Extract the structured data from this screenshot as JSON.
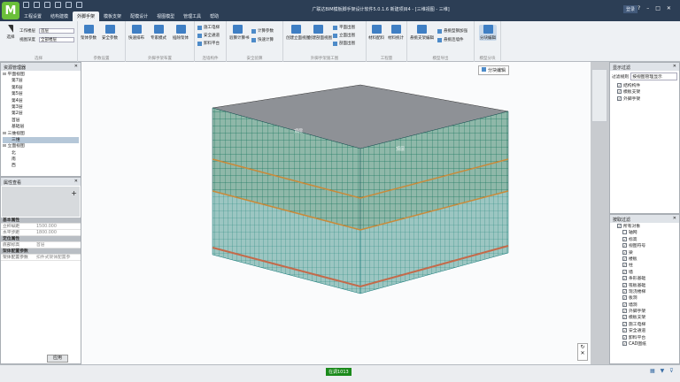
{
  "title": "广联达BIM模板脚手架设计软件5.0.1.6 新建项目4 - [三维视图 - 三维]",
  "menu": [
    "工程设置",
    "结构建模",
    "外脚手架",
    "模板支架",
    "配模设计",
    "视图模型",
    "管理工具",
    "帮助"
  ],
  "menu_active_index": 2,
  "login_label": "登录",
  "ribbon": {
    "select_label": "选择",
    "work_level_label": "工作楼层",
    "work_level_value": "首层",
    "view_type_label": "视图深度",
    "view_type_value": "全部楼层",
    "groups": [
      {
        "label": "选择",
        "buttons": []
      },
      {
        "label": "参数设置",
        "buttons": [
          "架体参数",
          "安全参数"
        ]
      },
      {
        "label": "外脚手架布置",
        "buttons": [
          "快速排布",
          "专家模式",
          "插除架体"
        ]
      },
      {
        "label": "连墙构件",
        "buttons": [
          "施工电梯",
          "安全通道",
          "卸料平台"
        ]
      },
      {
        "label": "安全验算",
        "buttons": [
          "验算计算书",
          "计算参数",
          "快速计算"
        ]
      },
      {
        "label": "外脚手架施工图",
        "buttons": [
          "创建立面视图",
          "创建剖面视图",
          "平面出图",
          "立面出图",
          "剖面出图"
        ]
      },
      {
        "label": "工程量",
        "buttons": [
          "材料配料",
          "材料统计"
        ]
      },
      {
        "label": "模型导出",
        "buttons": [
          "悬挑支架编辑",
          "悬挑型钢加强",
          "悬挑连墙件"
        ]
      },
      {
        "label": "模型分块",
        "buttons": [
          "分块编辑"
        ]
      }
    ]
  },
  "resource_panel": {
    "title": "资源管理器",
    "items": [
      {
        "label": "平面视图",
        "depth": 0,
        "expanded": true
      },
      {
        "label": "第7层",
        "depth": 2
      },
      {
        "label": "第6层",
        "depth": 2
      },
      {
        "label": "第5层",
        "depth": 2
      },
      {
        "label": "第4层",
        "depth": 2
      },
      {
        "label": "第3层",
        "depth": 2
      },
      {
        "label": "第2层",
        "depth": 2
      },
      {
        "label": "首层",
        "depth": 2
      },
      {
        "label": "基础层",
        "depth": 2
      },
      {
        "label": "三维视图",
        "depth": 0,
        "expanded": true
      },
      {
        "label": "三维",
        "depth": 2,
        "selected": true
      },
      {
        "label": "立面视图",
        "depth": 0,
        "expanded": true
      },
      {
        "label": "北",
        "depth": 2
      },
      {
        "label": "南",
        "depth": 2
      },
      {
        "label": "西",
        "depth": 2
      }
    ]
  },
  "properties_panel": {
    "title": "属性查看",
    "rows": [
      {
        "section": "基本属性"
      },
      {
        "key": "立杆纵距",
        "value": "1500.000"
      },
      {
        "key": "水平步距",
        "value": "1800.000"
      },
      {
        "section": "定位属性"
      },
      {
        "key": "底部标高",
        "value": "首层"
      },
      {
        "section": "架体配置参数"
      },
      {
        "key": "架体配置参数",
        "value": "扣件式架体配置参"
      }
    ],
    "apply_label": "应用"
  },
  "viewport": {
    "tool_label": "分块编辑",
    "floor_tags": [
      "顶层",
      "顶层"
    ]
  },
  "display_filter": {
    "title": "显示过滤",
    "mode_label": "过滤规则",
    "mode_value": "按视图管理显示",
    "items": [
      {
        "label": "结构构件",
        "checked": true
      },
      {
        "label": "模板支架",
        "checked": true
      },
      {
        "label": "外脚手架",
        "checked": true
      }
    ]
  },
  "select_filter": {
    "title": "按取过滤",
    "items": [
      {
        "label": "所有对象",
        "checked": true,
        "depth": 0
      },
      {
        "label": "轴网",
        "checked": false,
        "depth": 1
      },
      {
        "label": "标高",
        "checked": true,
        "depth": 1
      },
      {
        "label": "视图符号",
        "checked": true,
        "depth": 1
      },
      {
        "label": "梁",
        "checked": true,
        "depth": 1
      },
      {
        "label": "楼板",
        "checked": true,
        "depth": 1
      },
      {
        "label": "柱",
        "checked": true,
        "depth": 1
      },
      {
        "label": "墙",
        "checked": true,
        "depth": 1
      },
      {
        "label": "条形基础",
        "checked": true,
        "depth": 1
      },
      {
        "label": "筏板基础",
        "checked": true,
        "depth": 1
      },
      {
        "label": "现浇楼梯",
        "checked": true,
        "depth": 1
      },
      {
        "label": "板洞",
        "checked": true,
        "depth": 1
      },
      {
        "label": "墙洞",
        "checked": true,
        "depth": 1
      },
      {
        "label": "外脚手架",
        "checked": true,
        "depth": 1
      },
      {
        "label": "模板支架",
        "checked": true,
        "depth": 1
      },
      {
        "label": "施工电梯",
        "checked": true,
        "depth": 1
      },
      {
        "label": "安全通道",
        "checked": true,
        "depth": 1
      },
      {
        "label": "卸料平台",
        "checked": true,
        "depth": 1
      },
      {
        "label": "CAD图纸",
        "checked": true,
        "depth": 1
      }
    ]
  },
  "status_text": "在调1013"
}
